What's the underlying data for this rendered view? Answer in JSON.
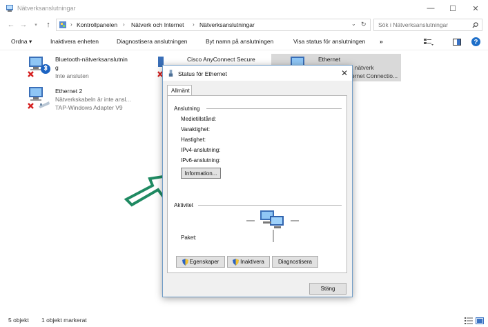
{
  "window": {
    "title": "Nätverksanslutningar",
    "controls": {
      "minimize": "—",
      "maximize": "☐",
      "close": "✕"
    }
  },
  "address": {
    "breadcrumbs": [
      "Kontrollpanelen",
      "Nätverk och Internet",
      "Nätverksanslutningar"
    ],
    "search_placeholder": "Sök i Nätverksanslutningar"
  },
  "commands": {
    "organize": "Ordna ▾",
    "disable": "Inaktivera enheten",
    "diagnose": "Diagnostisera anslutningen",
    "rename": "Byt namn på anslutningen",
    "status": "Visa status för anslutningen",
    "more": "»"
  },
  "connections": [
    {
      "name": "Bluetooth-nätverksanslutnin",
      "name2": "g",
      "status": "Inte ansluten",
      "adapter": ""
    },
    {
      "name": "Ethernet 2",
      "status": "Nätverkskabeln är inte ansl...",
      "adapter": "TAP-Windows Adapter V9"
    },
    {
      "name": "Cisco AnyConnect Secure",
      "status": "",
      "adapter": ""
    },
    {
      "name": "Ethernet",
      "status": "t nätverk",
      "adapter": "ernet Connectio..."
    }
  ],
  "statusbar": {
    "count": "5 objekt",
    "selected": "1 objekt markerat"
  },
  "dialog": {
    "title": "Status för Ethernet",
    "close": "✕",
    "tab": "Allmänt",
    "connection_group": "Anslutning",
    "fields": [
      "Medietillstånd:",
      "Varaktighet:",
      "Hastighet:",
      "IPv4-anslutning:",
      "IPv6-anslutning:"
    ],
    "info_button": "Information...",
    "activity_group": "Aktivitet",
    "packets_label": "Paket:",
    "properties_button": "Egenskaper",
    "disable_button": "Inaktivera",
    "diagnose_button": "Diagnostisera",
    "close_button": "Stäng"
  },
  "colors": {
    "arrow": "#1f8a62",
    "accent": "#0078d7",
    "selected": "#d9d9d9"
  }
}
